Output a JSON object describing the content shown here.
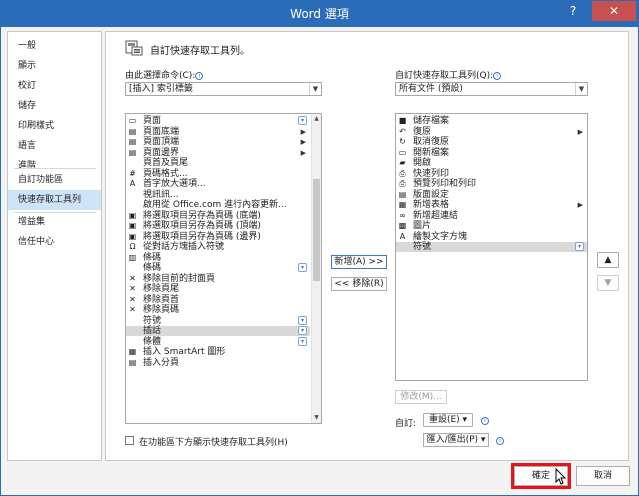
{
  "window": {
    "title": "Word 選項",
    "help": "?",
    "close": "✕"
  },
  "nav": {
    "items": [
      {
        "label": "一般"
      },
      {
        "label": "顯示"
      },
      {
        "label": "校訂"
      },
      {
        "label": "儲存"
      },
      {
        "label": "印刷樣式"
      },
      {
        "label": "語言"
      },
      {
        "label": "進階"
      },
      {
        "label": "自訂功能區"
      },
      {
        "label": "快速存取工具列"
      },
      {
        "label": "增益集"
      },
      {
        "label": "信任中心"
      }
    ]
  },
  "header": {
    "text": "自訂快速存取工具列。"
  },
  "left": {
    "choose_label": "由此選擇命令(C):",
    "choose_value": "[插入] 索引標籤",
    "items": [
      {
        "label": "頁面",
        "icon": "document-icon",
        "glyph": "▭",
        "mark": "dropdown"
      },
      {
        "label": "頁面底端",
        "icon": "page-bottom-icon",
        "glyph": "▤",
        "mark": "submenu"
      },
      {
        "label": "頁面頂端",
        "icon": "page-top-icon",
        "glyph": "▤",
        "mark": "submenu"
      },
      {
        "label": "頁面邊界",
        "icon": "page-margin-icon",
        "glyph": "▤",
        "mark": "submenu"
      },
      {
        "label": "頁首及頁尾",
        "icon": "",
        "glyph": "",
        "mark": ""
      },
      {
        "label": "頁碼格式...",
        "icon": "page-number-format-icon",
        "glyph": "#",
        "mark": ""
      },
      {
        "label": "首字放大選項...",
        "icon": "drop-cap-icon",
        "glyph": "A",
        "mark": ""
      },
      {
        "label": "視訊訊...",
        "icon": "",
        "glyph": "",
        "mark": ""
      },
      {
        "label": "啟用從 Office.com 進行內容更新...",
        "icon": "",
        "glyph": "",
        "mark": ""
      },
      {
        "label": "將選取項目另存為頁碼 (底端)",
        "icon": "save-selection-icon",
        "glyph": "▣",
        "mark": ""
      },
      {
        "label": "將選取項目另存為頁碼 (頂端)",
        "icon": "save-selection-icon",
        "glyph": "▣",
        "mark": ""
      },
      {
        "label": "將選取項目另存為頁碼 (邊界)",
        "icon": "save-selection-icon",
        "glyph": "▣",
        "mark": ""
      },
      {
        "label": "從對話方塊插入符號",
        "icon": "omega-icon",
        "glyph": "Ω",
        "mark": ""
      },
      {
        "label": "條碼",
        "icon": "barcode-icon",
        "glyph": "▥",
        "mark": ""
      },
      {
        "label": "條碼",
        "icon": "",
        "glyph": "",
        "mark": "dropdown"
      },
      {
        "label": "移除目前的封面頁",
        "icon": "remove-icon",
        "glyph": "✕",
        "mark": ""
      },
      {
        "label": "移除頁尾",
        "icon": "remove-icon",
        "glyph": "✕",
        "mark": ""
      },
      {
        "label": "移除頁首",
        "icon": "remove-icon",
        "glyph": "✕",
        "mark": ""
      },
      {
        "label": "移除頁碼",
        "icon": "remove-icon",
        "glyph": "✕",
        "mark": ""
      },
      {
        "label": "符號",
        "icon": "",
        "glyph": "",
        "mark": "dropdown"
      },
      {
        "label": "插話",
        "icon": "",
        "glyph": "",
        "mark": "dropdown"
      },
      {
        "label": "條體",
        "icon": "",
        "glyph": "",
        "mark": "dropdown"
      },
      {
        "label": "插入 SmartArt 圖形",
        "icon": "smartart-icon",
        "glyph": "▦",
        "mark": ""
      },
      {
        "label": "插入分頁",
        "icon": "page-break-icon",
        "glyph": "▤",
        "mark": ""
      }
    ],
    "selected_index": 20,
    "checkbox_label": "在功能區下方顯示快速存取工具列(H)"
  },
  "middle": {
    "add_label": "新增(A) >>",
    "remove_label": "<< 移除(R)"
  },
  "right": {
    "customize_label": "自訂快速存取工具列(Q):",
    "customize_value": "所有文件 (預設)",
    "items": [
      {
        "label": "儲存檔案",
        "icon": "save-icon",
        "glyph": "■",
        "mark": ""
      },
      {
        "label": "復原",
        "icon": "undo-icon",
        "glyph": "↶",
        "mark": "submenu"
      },
      {
        "label": "取消復原",
        "icon": "redo-icon",
        "glyph": "↻",
        "mark": ""
      },
      {
        "label": "開新檔案",
        "icon": "new-file-icon",
        "glyph": "▭",
        "mark": ""
      },
      {
        "label": "開啟",
        "icon": "open-folder-icon",
        "glyph": "▰",
        "mark": ""
      },
      {
        "label": "快速列印",
        "icon": "print-icon",
        "glyph": "⎙",
        "mark": ""
      },
      {
        "label": "預覽列印和列印",
        "icon": "print-preview-icon",
        "glyph": "⎙",
        "mark": ""
      },
      {
        "label": "版面設定",
        "icon": "page-setup-icon",
        "glyph": "▤",
        "mark": ""
      },
      {
        "label": "新增表格",
        "icon": "table-icon",
        "glyph": "▦",
        "mark": "submenu"
      },
      {
        "label": "新增超連結",
        "icon": "hyperlink-icon",
        "glyph": "∞",
        "mark": ""
      },
      {
        "label": "圖片",
        "icon": "picture-icon",
        "glyph": "▩",
        "mark": ""
      },
      {
        "label": "繪製文字方塊",
        "icon": "text-box-icon",
        "glyph": "A",
        "mark": ""
      },
      {
        "label": "符號",
        "icon": "",
        "glyph": "",
        "mark": "dropdown"
      }
    ],
    "selected_index": 12,
    "modify_label": "修改(M)...",
    "customizations_label": "自訂:",
    "reset_label": "重設(E) ▾",
    "import_export_label": "匯入/匯出(P) ▾"
  },
  "footer": {
    "ok_label": "確定",
    "cancel_label": "取消"
  },
  "colors": {
    "titlebar": "#2b6cb9",
    "nav_active": "#cde3f7",
    "highlight": "#e8141c"
  }
}
